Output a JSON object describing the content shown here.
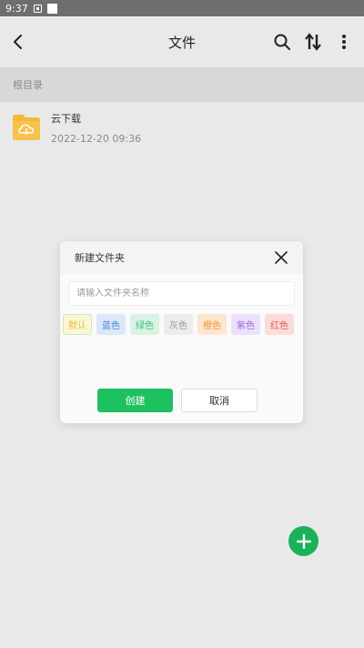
{
  "status_bar": {
    "time": "9:37"
  },
  "header": {
    "title": "文件"
  },
  "breadcrumb": {
    "label": "根目录"
  },
  "files": [
    {
      "name": "云下载",
      "date": "2022-12-20 09:36"
    }
  ],
  "dialog": {
    "title": "新建文件夹",
    "input_placeholder": "请输入文件夹名称",
    "input_value": "",
    "colors": [
      {
        "label": "默认",
        "text_color": "#e8c230",
        "bg": "#fbf6d8",
        "border": "#cfe8b8",
        "selected": true
      },
      {
        "label": "蓝色",
        "text_color": "#4a86d6",
        "bg": "#dbe8fa",
        "border": "#dbe8fa"
      },
      {
        "label": "绿色",
        "text_color": "#3ebd7b",
        "bg": "#d9f2e3",
        "border": "#d9f2e3"
      },
      {
        "label": "灰色",
        "text_color": "#9a9a9a",
        "bg": "#ececec",
        "border": "#ececec"
      },
      {
        "label": "橙色",
        "text_color": "#f0962e",
        "bg": "#fde6cf",
        "border": "#fde6cf"
      },
      {
        "label": "紫色",
        "text_color": "#9a6ddb",
        "bg": "#ebe0fa",
        "border": "#ebe0fa"
      },
      {
        "label": "红色",
        "text_color": "#e25b52",
        "bg": "#fbdcd8",
        "border": "#fbdcd8"
      }
    ],
    "create_label": "创建",
    "cancel_label": "取消"
  },
  "colors": {
    "accent": "#1ec15f",
    "fab": "#1ab258",
    "folder": "#f2b83a"
  },
  "icons": [
    "back-arrow-icon",
    "search-icon",
    "sort-icon",
    "more-vertical-icon",
    "folder-cloud-icon",
    "close-icon",
    "plus-icon"
  ]
}
